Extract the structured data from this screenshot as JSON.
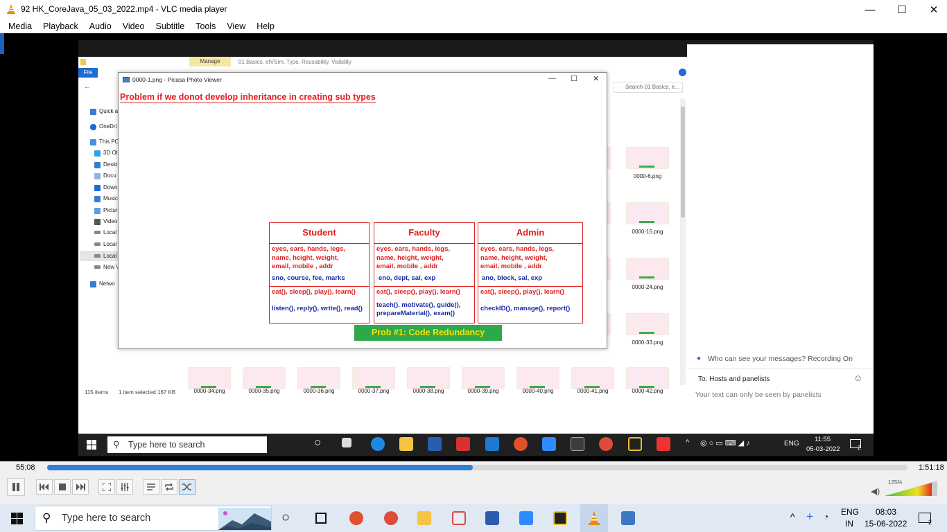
{
  "window": {
    "title": "92 HK_CoreJava_05_03_2022.mp4 - VLC media player",
    "minimize": "—",
    "maximize": "☐",
    "close": "✕"
  },
  "menu": [
    "Media",
    "Playback",
    "Audio",
    "Video",
    "Subtitle",
    "Tools",
    "View",
    "Help"
  ],
  "explorer": {
    "ribbon_manage": "Manage",
    "path": "01 Basics, etVSim, Type, Reusability, Visibility",
    "file_tab": "File",
    "search_placeholder": "Search 01 Basics, e...",
    "nav": [
      "Quick a",
      "OneDri",
      "This PC",
      "3D Ol",
      "Deskt",
      "Docu",
      "Down",
      "Music",
      "Pictur",
      "Video",
      "Local",
      "Local",
      "Local",
      "New V",
      "Netwo"
    ],
    "thumbs_right": [
      "0000-6.png",
      "0000-15.png",
      "0000-24.png",
      "0000-33.png"
    ],
    "thumbs_bottom": [
      "0000-34.png",
      "0000-35.png",
      "0000-36.png",
      "0000-37.png",
      "0000-38.png",
      "0000-39.png",
      "0000-40.png",
      "0000-41.png",
      "0000-42.png"
    ],
    "status_items": "115 items",
    "status_selected": "1 item selected  167 KB"
  },
  "picasa": {
    "title": "0000-1.png - Picasa Photo Viewer",
    "heading": "Problem if we donot develop inheritance in creating sub types",
    "boxes": [
      {
        "name": "Student",
        "attrs_red": [
          "eyes, ears, hands, legs,",
          "name, height, weight,",
          "email, mobile , addr"
        ],
        "attrs_blue": "sno, course, fee, marks",
        "meth_red": "eat(), sleep(), play(), learn()",
        "meth_blue": [
          "listen(), reply(), write(), read()"
        ]
      },
      {
        "name": "Faculty",
        "attrs_red": [
          "eyes, ears, hands, legs,",
          "name, height, weight,",
          "email, mobile , addr"
        ],
        "attrs_blue": "eno, dept, sal, exp",
        "meth_red": "eat(), sleep(), play(), learn()",
        "meth_blue": [
          "teach(), motivate(), guide(),",
          "prepareMaterial(), exam()"
        ]
      },
      {
        "name": "Admin",
        "attrs_red": [
          "eyes, ears, hands, legs,",
          "name, height, weight,",
          "email, mobile , addr"
        ],
        "attrs_blue": "ano, block, sal, exp",
        "meth_red": "eat(), sleep(), play(), learn()",
        "meth_blue": [
          "checkID(), manage(), report()"
        ]
      }
    ],
    "banner": "Prob #1: Code Redundancy"
  },
  "chat": {
    "recording": "Who can see your messages? Recording On",
    "to": "To:  Hosts and panelists",
    "placeholder": "Your text can only be seen by panelists"
  },
  "inner_taskbar": {
    "search": "Type here to search",
    "lang": "ENG",
    "time": "11:55",
    "date": "05-03-2022",
    "notif": "2"
  },
  "player": {
    "elapsed": "55:08",
    "total": "1:51:18",
    "progress_fraction": 0.495,
    "volume": "125%",
    "accent": "#2e7fd8"
  },
  "taskbar": {
    "search": "Type here to search",
    "lang1": "ENG",
    "lang2": "IN",
    "time": "08:03",
    "date": "15-06-2022",
    "notif": "2"
  }
}
